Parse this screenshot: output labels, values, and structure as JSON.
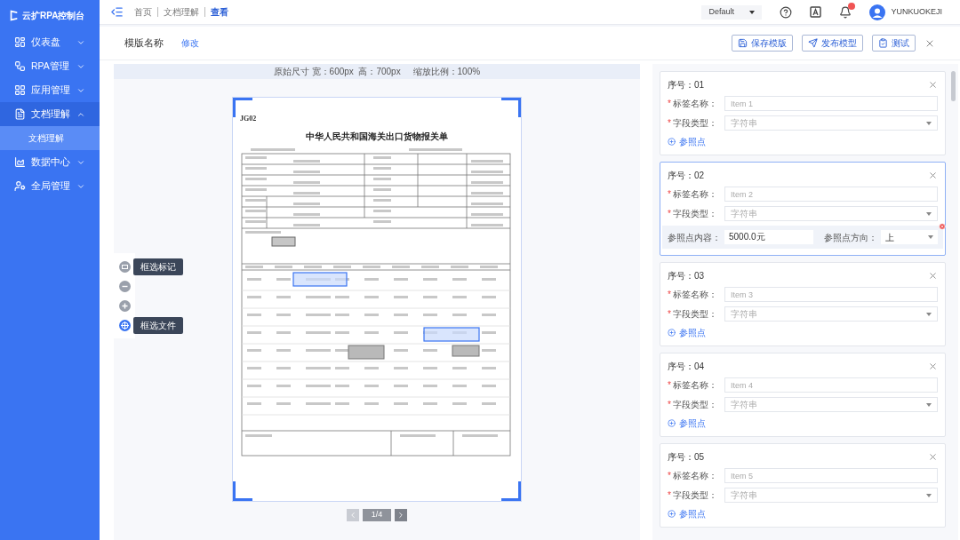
{
  "brand": "云扩RPA控制台",
  "nav": [
    {
      "label": "仪表盘",
      "expanded": false
    },
    {
      "label": "RPA管理",
      "expanded": false
    },
    {
      "label": "应用管理",
      "expanded": false
    },
    {
      "label": "文档理解",
      "expanded": true,
      "children": [
        {
          "label": "文档理解",
          "selected": true
        }
      ]
    },
    {
      "label": "数据中心",
      "expanded": false
    },
    {
      "label": "全局管理",
      "expanded": false
    }
  ],
  "breadcrumb": [
    {
      "label": "首页",
      "current": false
    },
    {
      "label": "文档理解",
      "current": false
    },
    {
      "label": "查看",
      "current": true
    }
  ],
  "theme_select": "Default",
  "user": "YUNKUOKEJI",
  "page_title": "模版名称",
  "edit_link": "修改",
  "actions": [
    {
      "label": "保存模版"
    },
    {
      "label": "发布模型"
    },
    {
      "label": "测试"
    }
  ],
  "info_bar": "原始尺寸 宽：600px  高：700px     缩放比例：100%",
  "tools": [
    {
      "kind": "mark",
      "tooltip": "框选标记",
      "selected": false
    },
    {
      "kind": "zoom-out",
      "selected": false
    },
    {
      "kind": "zoom-in",
      "selected": false
    },
    {
      "kind": "file",
      "tooltip": "框选文件",
      "selected": true
    }
  ],
  "document": {
    "code": "JG02",
    "title": "中华人民共和国海关出口货物报关单"
  },
  "pager": "1/4",
  "fields": [
    {
      "seq_label": "序号：",
      "seq": "01",
      "name_required": "*",
      "name_label": "标签名称：",
      "name_placeholder": "Item 1",
      "type_required": "*",
      "type_label": "字段类型：",
      "type_placeholder": "字符串",
      "selected": false,
      "ref_link": "参照点"
    },
    {
      "seq_label": "序号：",
      "seq": "02",
      "name_required": "*",
      "name_label": "标签名称：",
      "name_placeholder": "Item 2",
      "type_required": "*",
      "type_label": "字段类型：",
      "type_placeholder": "字符串",
      "selected": true,
      "reference": {
        "content_label": "参照点内容：",
        "content": "5000.0元",
        "direction_label": "参照点方向：",
        "direction": "上"
      }
    },
    {
      "seq_label": "序号：",
      "seq": "03",
      "name_required": "*",
      "name_label": "标签名称：",
      "name_placeholder": "Item 3",
      "type_required": "*",
      "type_label": "字段类型：",
      "type_placeholder": "字符串",
      "selected": false,
      "ref_link": "参照点"
    },
    {
      "seq_label": "序号：",
      "seq": "04",
      "name_required": "*",
      "name_label": "标签名称：",
      "name_placeholder": "Item 4",
      "type_required": "*",
      "type_label": "字段类型：",
      "type_placeholder": "字符串",
      "selected": false,
      "ref_link": "参照点"
    },
    {
      "seq_label": "序号：",
      "seq": "05",
      "name_required": "*",
      "name_label": "标签名称：",
      "name_placeholder": "Item 5",
      "type_required": "*",
      "type_label": "字段类型：",
      "type_placeholder": "字符串",
      "selected": false,
      "ref_link": "参照点"
    }
  ]
}
